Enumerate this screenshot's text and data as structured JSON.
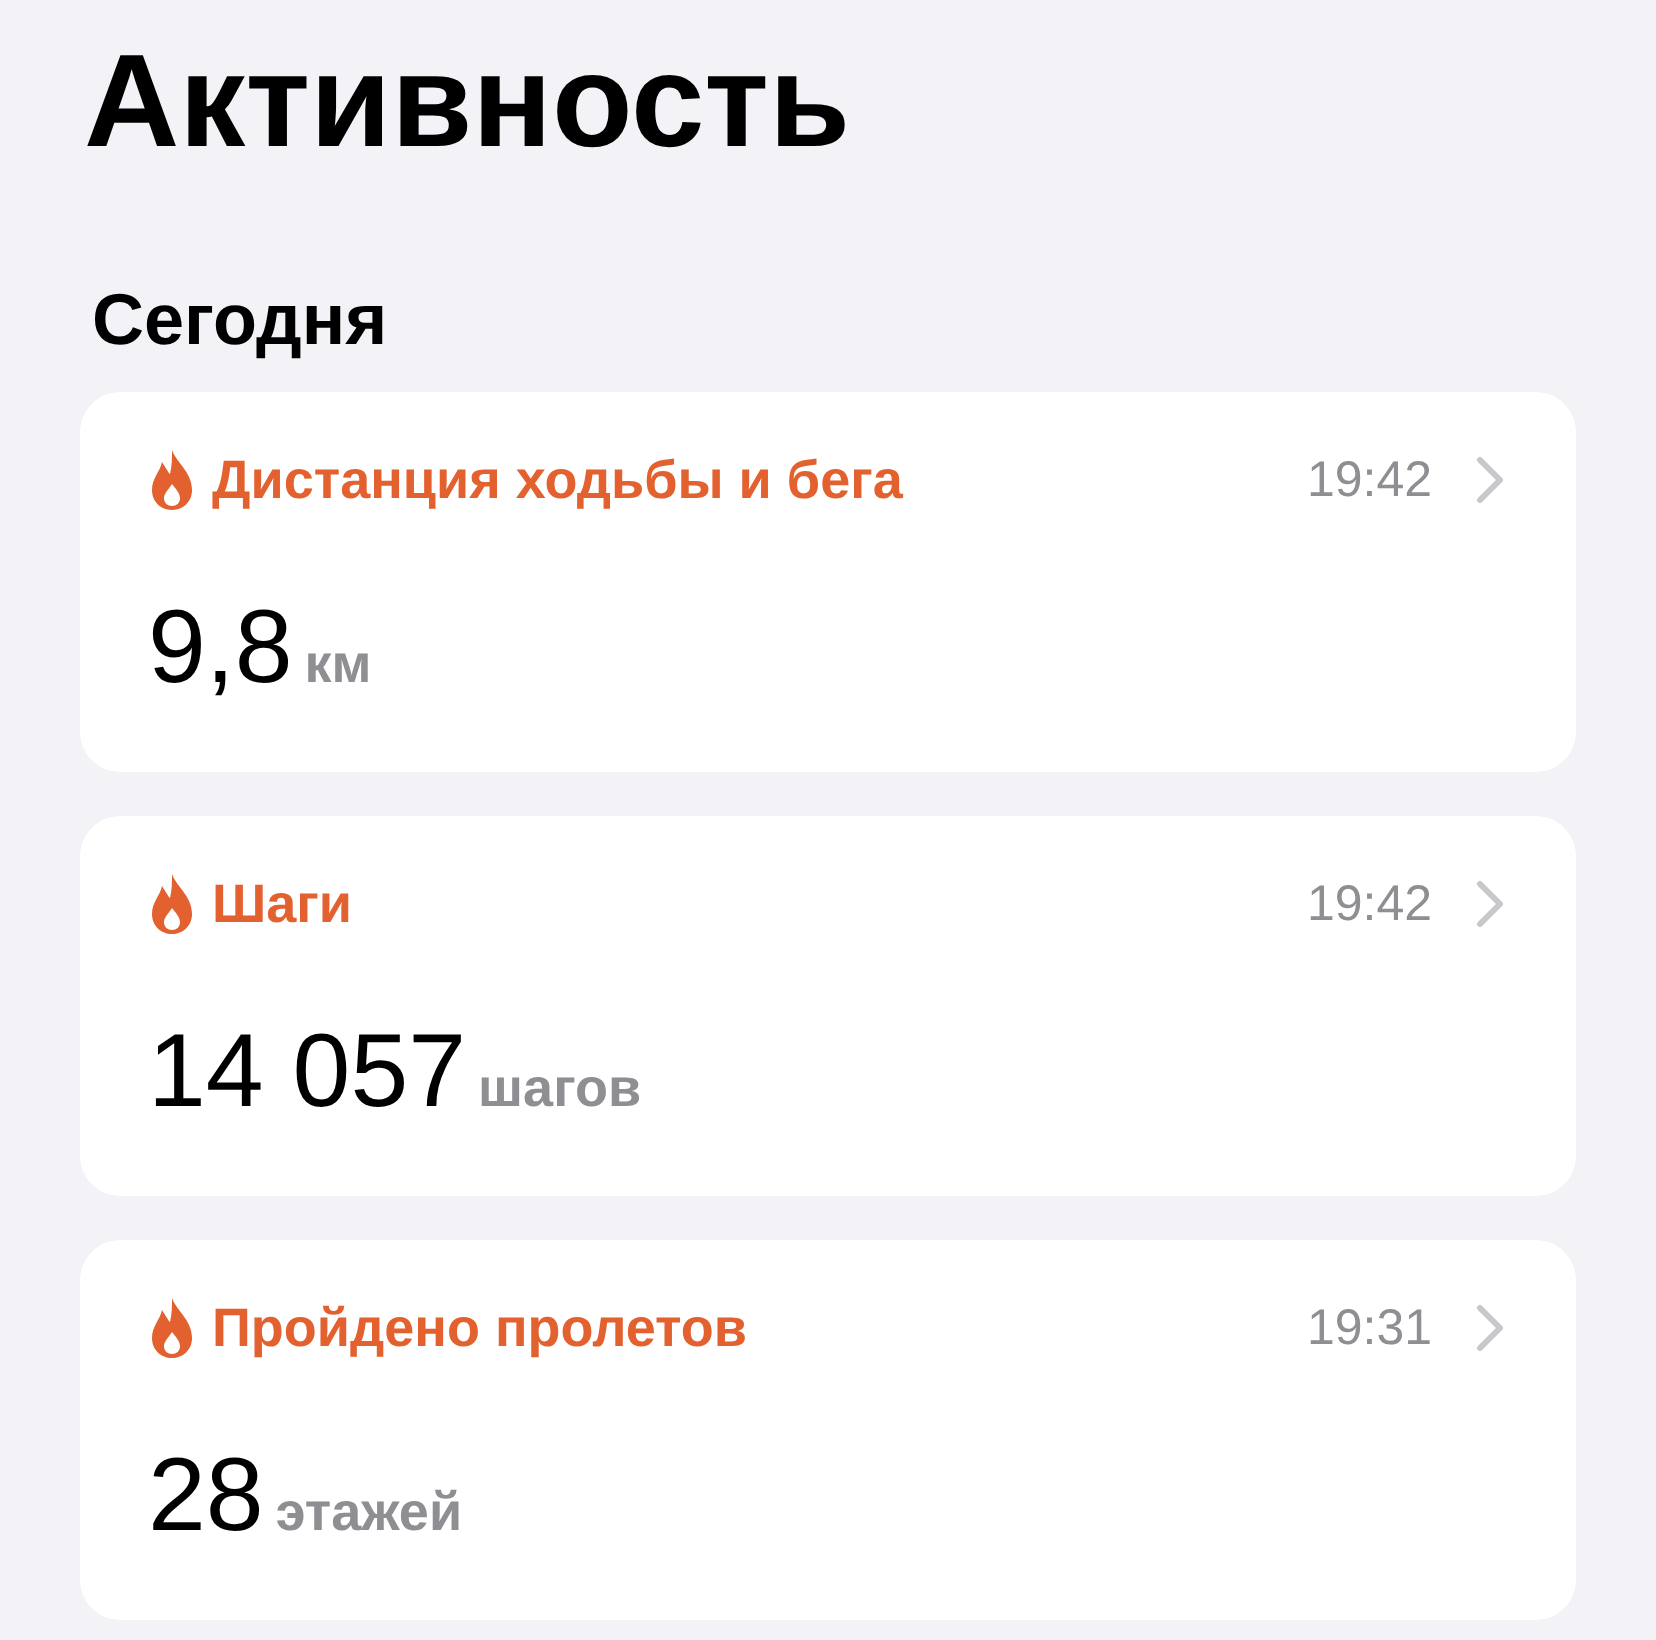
{
  "title": "Активность",
  "section": "Сегодня",
  "cards": [
    {
      "label": "Дистанция ходьбы и бега",
      "time": "19:42",
      "value": "9,8",
      "unit": "км"
    },
    {
      "label": "Шаги",
      "time": "19:42",
      "value": "14 057",
      "unit": "шагов"
    },
    {
      "label": "Пройдено пролетов",
      "time": "19:31",
      "value": "28",
      "unit": "этажей"
    }
  ]
}
